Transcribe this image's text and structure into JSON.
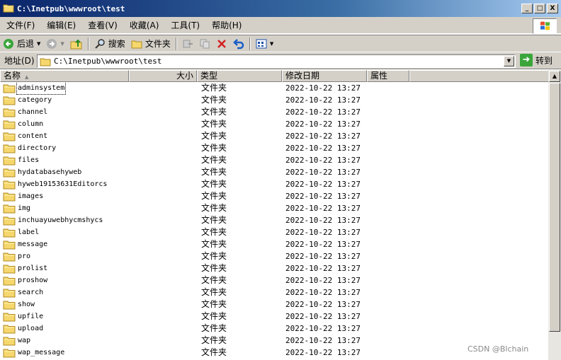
{
  "window": {
    "title": "C:\\Inetpub\\wwwroot\\test",
    "minimize_label": "_",
    "maximize_label": "□",
    "close_label": "X"
  },
  "menu": [
    {
      "label": "文件(F)"
    },
    {
      "label": "编辑(E)"
    },
    {
      "label": "查看(V)"
    },
    {
      "label": "收藏(A)"
    },
    {
      "label": "工具(T)"
    },
    {
      "label": "帮助(H)"
    }
  ],
  "toolbar": {
    "back_label": "后退",
    "search_label": "搜索",
    "folders_label": "文件夹"
  },
  "address": {
    "label": "地址(D)",
    "value": "C:\\Inetpub\\wwwroot\\test",
    "go_label": "转到"
  },
  "columns": {
    "name": "名称",
    "size": "大小",
    "type": "类型",
    "modified": "修改日期",
    "attributes": "属性"
  },
  "files": [
    {
      "name": "adminsystem",
      "type": "文件夹",
      "modified": "2022-10-22 13:27"
    },
    {
      "name": "category",
      "type": "文件夹",
      "modified": "2022-10-22 13:27"
    },
    {
      "name": "channel",
      "type": "文件夹",
      "modified": "2022-10-22 13:27"
    },
    {
      "name": "column",
      "type": "文件夹",
      "modified": "2022-10-22 13:27"
    },
    {
      "name": "content",
      "type": "文件夹",
      "modified": "2022-10-22 13:27"
    },
    {
      "name": "directory",
      "type": "文件夹",
      "modified": "2022-10-22 13:27"
    },
    {
      "name": "files",
      "type": "文件夹",
      "modified": "2022-10-22 13:27"
    },
    {
      "name": "hydatabasehyweb",
      "type": "文件夹",
      "modified": "2022-10-22 13:27"
    },
    {
      "name": "hyweb19153631Editorcs",
      "type": "文件夹",
      "modified": "2022-10-22 13:27"
    },
    {
      "name": "images",
      "type": "文件夹",
      "modified": "2022-10-22 13:27"
    },
    {
      "name": "img",
      "type": "文件夹",
      "modified": "2022-10-22 13:27"
    },
    {
      "name": "inchuayuwebhycmshycs",
      "type": "文件夹",
      "modified": "2022-10-22 13:27"
    },
    {
      "name": "label",
      "type": "文件夹",
      "modified": "2022-10-22 13:27"
    },
    {
      "name": "message",
      "type": "文件夹",
      "modified": "2022-10-22 13:27"
    },
    {
      "name": "pro",
      "type": "文件夹",
      "modified": "2022-10-22 13:27"
    },
    {
      "name": "prolist",
      "type": "文件夹",
      "modified": "2022-10-22 13:27"
    },
    {
      "name": "proshow",
      "type": "文件夹",
      "modified": "2022-10-22 13:27"
    },
    {
      "name": "search",
      "type": "文件夹",
      "modified": "2022-10-22 13:27"
    },
    {
      "name": "show",
      "type": "文件夹",
      "modified": "2022-10-22 13:27"
    },
    {
      "name": "upfile",
      "type": "文件夹",
      "modified": "2022-10-22 13:27"
    },
    {
      "name": "upload",
      "type": "文件夹",
      "modified": "2022-10-22 13:27"
    },
    {
      "name": "wap",
      "type": "文件夹",
      "modified": "2022-10-22 13:27"
    },
    {
      "name": "wap_message",
      "type": "文件夹",
      "modified": "2022-10-22 13:27"
    }
  ],
  "watermark": "CSDN @Blchain",
  "colors": {
    "titlebar": "#0a246a",
    "chrome": "#d4d0c8",
    "folder": "#f5d76e"
  }
}
